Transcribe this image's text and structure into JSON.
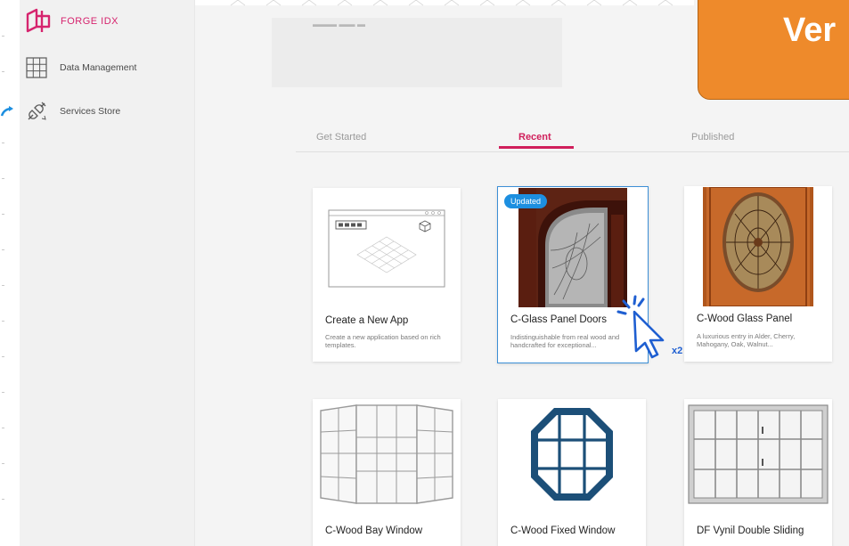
{
  "app": {
    "brand_label": "FORGE IDX"
  },
  "sidebar": {
    "items": [
      {
        "label": "Data Management",
        "icon": "grid-icon"
      },
      {
        "label": "Services Store",
        "icon": "plug-icon"
      }
    ]
  },
  "banner": {
    "text": "Ver",
    "color": "#ee8a2b"
  },
  "tabs": [
    {
      "label": "Get Started",
      "active": false
    },
    {
      "label": "Recent",
      "active": true
    },
    {
      "label": "Published",
      "active": false
    }
  ],
  "accent_color": "#d01f5b",
  "cards": [
    {
      "title": "Create a New App",
      "desc": "Create a new application based on rich templates.",
      "badge": ""
    },
    {
      "title": "C-Glass Panel Doors",
      "desc": "Indistinguishable from real wood and handcrafted for exceptional...",
      "badge": "Updated"
    },
    {
      "title": "C-Wood Glass Panel",
      "desc": "A luxurious entry in Alder, Cherry, Mahogany, Oak, Walnut...",
      "badge": ""
    },
    {
      "title": "C-Wood Bay Window",
      "desc": "",
      "badge": ""
    },
    {
      "title": "C-Wood Fixed Window",
      "desc": "",
      "badge": ""
    },
    {
      "title": "DF Vynil Double Sliding",
      "desc": "",
      "badge": ""
    }
  ],
  "cursor": {
    "click_count_label": "x2"
  }
}
